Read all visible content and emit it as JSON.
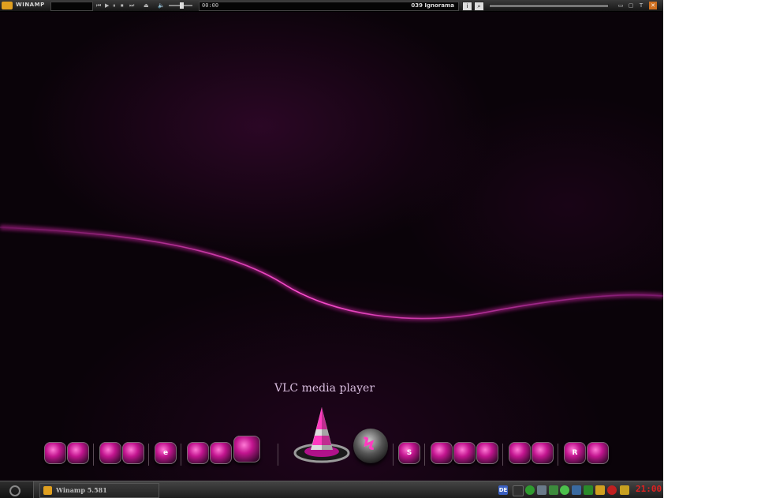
{
  "winamp": {
    "title": "WINAMP",
    "time": "00:00",
    "track": "039 Ignorama",
    "controls": [
      "⏮",
      "▶",
      "⏸",
      "⏹",
      "⏭",
      "⏏",
      "🔈"
    ],
    "info_button": "i",
    "search_button": "⌕",
    "window_buttons": [
      "▭",
      "▢",
      "T",
      "✕"
    ]
  },
  "dock": {
    "label": "VLC media player",
    "icons": [
      {
        "name": "dock-app-1",
        "glyph": ""
      },
      {
        "name": "dock-app-2",
        "glyph": ""
      },
      {
        "name": "dock-app-3",
        "glyph": ""
      },
      {
        "name": "dock-app-4",
        "glyph": ""
      },
      {
        "name": "dock-app-5",
        "glyph": "e"
      },
      {
        "name": "dock-app-6",
        "glyph": ""
      },
      {
        "name": "dock-app-7",
        "glyph": ""
      },
      {
        "name": "dock-app-8",
        "glyph": ""
      },
      {
        "name": "dock-app-9",
        "glyph": "S"
      },
      {
        "name": "dock-app-10",
        "glyph": ""
      },
      {
        "name": "dock-app-11",
        "glyph": ""
      },
      {
        "name": "dock-app-12",
        "glyph": ""
      },
      {
        "name": "dock-app-13",
        "glyph": ""
      },
      {
        "name": "dock-app-14",
        "glyph": ""
      },
      {
        "name": "dock-app-15",
        "glyph": "S"
      },
      {
        "name": "dock-app-16",
        "glyph": ""
      },
      {
        "name": "dock-app-17",
        "glyph": ""
      },
      {
        "name": "dock-app-18",
        "glyph": ""
      },
      {
        "name": "dock-app-19",
        "glyph": "R"
      },
      {
        "name": "dock-app-20",
        "glyph": ""
      }
    ]
  },
  "taskbar": {
    "task_label": "Winamp 5.581",
    "lang": "DE",
    "clock": "21:00"
  },
  "colors": {
    "accent": "#c2158f",
    "background": "#0a0309",
    "clock": "#e02020"
  }
}
